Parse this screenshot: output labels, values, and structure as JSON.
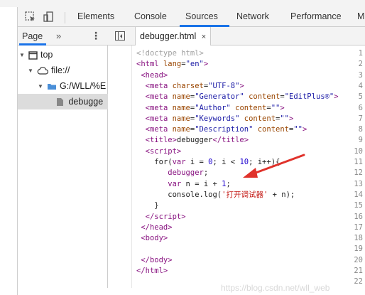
{
  "tabs": [
    "Elements",
    "Console",
    "Sources",
    "Network",
    "Performance",
    "M"
  ],
  "active_tab": "Sources",
  "navigator": {
    "tab_label": "Page",
    "more_label": "»",
    "menu_label": "⋮",
    "tree": [
      "top",
      "file://",
      "G:/WLL/%E",
      "debugge"
    ]
  },
  "editor": {
    "file_tab": "debugger.html",
    "close_label": "×",
    "line_numbers": [
      "1",
      "2",
      "3",
      "4",
      "5",
      "6",
      "7",
      "8",
      "9",
      "10",
      "11",
      "12",
      "13",
      "14",
      "15",
      "16",
      "17",
      "18",
      "19",
      "20",
      "21",
      "22"
    ]
  },
  "watermark": "https://blog.csdn.net/wll_web",
  "colors": {
    "accent": "#1a73e8",
    "folder": "#4a8fd8",
    "arrow": "#e0322b",
    "tag": "#881280",
    "attr": "#994500",
    "value": "#1a1aa6"
  },
  "icons": [
    "inspect-icon",
    "device-toggle-icon",
    "pane-toggle-icon",
    "window-icon",
    "cloud-icon",
    "folder-icon",
    "file-icon",
    "red-arrow"
  ]
}
